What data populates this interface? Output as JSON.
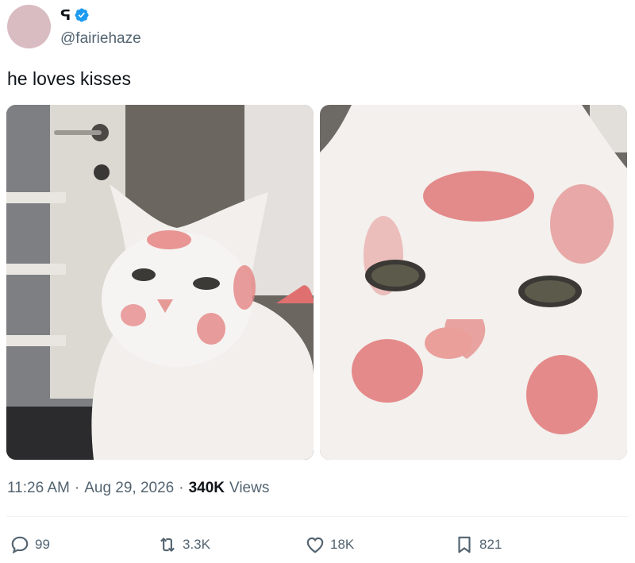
{
  "author": {
    "display_name": "ᕋ",
    "handle": "@fairiehaze",
    "verified": true,
    "avatar_color": "#d9bcc2"
  },
  "tweet": {
    "text": "he loves kisses"
  },
  "media": [
    {
      "description_icon": "photo-cat-with-lipstick-kisses-wide"
    },
    {
      "description_icon": "photo-cat-with-lipstick-kisses-closeup"
    }
  ],
  "meta": {
    "time": "11:26 AM",
    "separator": "·",
    "date": "Aug 29, 2026",
    "views_count": "340K",
    "views_label": "Views"
  },
  "actions": {
    "replies": "99",
    "reposts": "3.3K",
    "likes": "18K",
    "bookmarks": "821"
  },
  "colors": {
    "verified_blue": "#1d9bf0",
    "muted_text": "#536471",
    "primary_text": "#0f1419"
  }
}
